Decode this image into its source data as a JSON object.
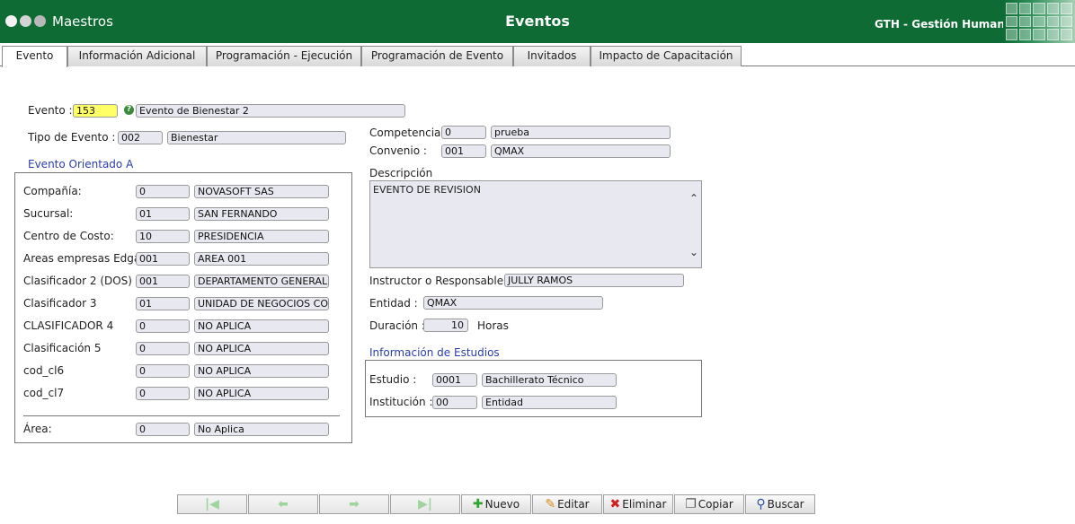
{
  "header": {
    "module": "Maestros",
    "title": "Eventos",
    "brand": "GTH - Gestión Humana"
  },
  "tabs": [
    {
      "label": "Evento"
    },
    {
      "label": "Información Adicional"
    },
    {
      "label": "Programación - Ejecución"
    },
    {
      "label": "Programación de Evento"
    },
    {
      "label": "Invitados"
    },
    {
      "label": "Impacto de Capacitación"
    }
  ],
  "evento": {
    "label": "Evento :",
    "code": "153",
    "name": "Evento de Bienestar 2"
  },
  "tipo_evento": {
    "label": "Tipo de Evento :",
    "code": "002",
    "name": "Bienestar"
  },
  "orientado": {
    "title": "Evento Orientado A",
    "rows": [
      {
        "label": "Compañía:",
        "code": "0",
        "name": "NOVASOFT SAS"
      },
      {
        "label": "Sucursal:",
        "code": "01",
        "name": "SAN FERNANDO"
      },
      {
        "label": "Centro de Costo:",
        "code": "10",
        "name": "PRESIDENCIA"
      },
      {
        "label": "Areas empresas Edgar",
        "code": "001",
        "name": "AREA 001"
      },
      {
        "label": "Clasificador 2 (DOS)",
        "code": "001",
        "name": "DEPARTAMENTO GENERAL"
      },
      {
        "label": "Clasificador 3",
        "code": "01",
        "name": "UNIDAD DE NEGOCIOS COMERCIAL"
      },
      {
        "label": "CLASIFICADOR 4",
        "code": "0",
        "name": "NO APLICA"
      },
      {
        "label": "Clasificación 5",
        "code": "0",
        "name": "NO APLICA"
      },
      {
        "label": "cod_cl6",
        "code": "0",
        "name": "NO APLICA"
      },
      {
        "label": "cod_cl7",
        "code": "0",
        "name": "NO APLICA"
      }
    ],
    "area": {
      "label": "Área:",
      "code": "0",
      "name": "No Aplica"
    }
  },
  "competencia": {
    "label": "Competencia :",
    "code": "0",
    "name": "prueba"
  },
  "convenio": {
    "label": "Convenio :",
    "code": "001",
    "name": "QMAX"
  },
  "descripcion": {
    "label": "Descripción",
    "value": "EVENTO DE REVISION"
  },
  "instructor": {
    "label": "Instructor o Responsable :",
    "value": "JULLY RAMOS"
  },
  "entidad": {
    "label": "Entidad :",
    "value": "QMAX"
  },
  "duracion": {
    "label": "Duración :",
    "value": "10",
    "unit": "Horas"
  },
  "estudios": {
    "title": "Información de Estudios",
    "estudio": {
      "label": "Estudio :",
      "code": "0001",
      "name": "Bachillerato Técnico"
    },
    "institucion": {
      "label": "Institución :",
      "code": "00",
      "name": "Entidad"
    }
  },
  "toolbar": {
    "nuevo": "Nuevo",
    "editar": "Editar",
    "eliminar": "Eliminar",
    "copiar": "Copiar",
    "buscar": "Buscar"
  },
  "colors": {
    "header_bg": "#0d6b33",
    "section_title": "#2a3cab",
    "code_highlight": "#ffff66"
  }
}
